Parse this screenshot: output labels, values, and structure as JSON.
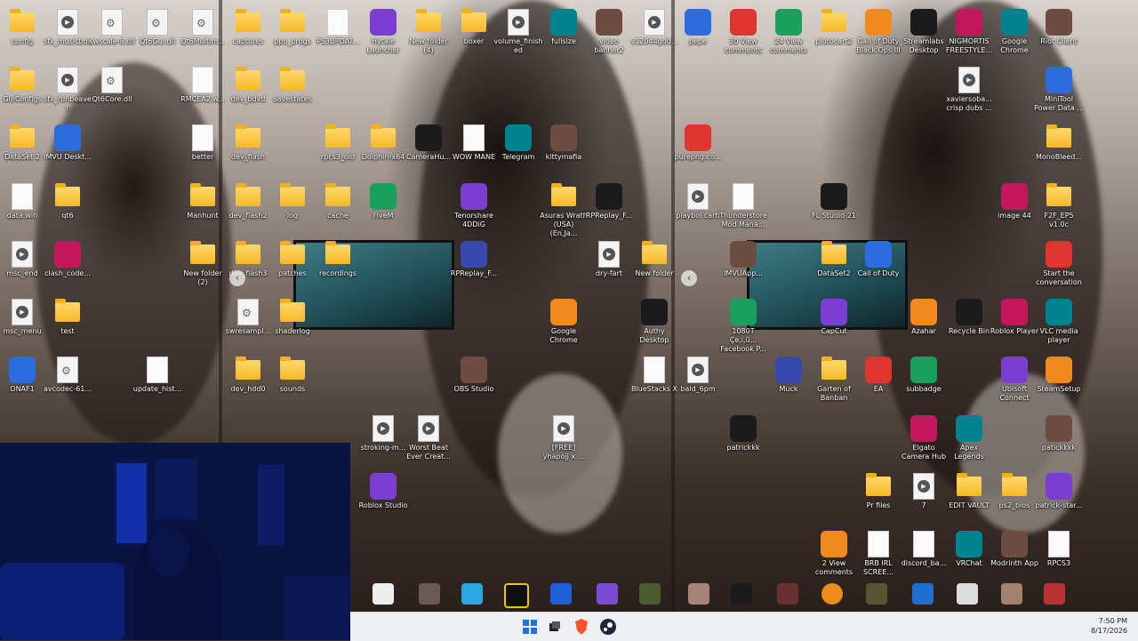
{
  "desktop": {
    "panel1": [
      {
        "label": "config",
        "type": "folder"
      },
      {
        "label": "sfx_musicbox",
        "type": "media"
      },
      {
        "label": "swscale-8.dll",
        "type": "gear"
      },
      {
        "label": "Qt6Gui.dll",
        "type": "gear"
      },
      {
        "label": "Qt6Multim...",
        "type": "gear"
      },
      {
        "label": "GuiConfigs",
        "type": "folder"
      },
      {
        "label": "sfx_runbeaver",
        "type": "media"
      },
      {
        "label": "Qt6Core.dll",
        "type": "gear"
      },
      {
        "label": "RMCEA2.w...",
        "type": "doc"
      },
      {
        "label": "DataSet 2",
        "type": "folder"
      },
      {
        "label": "IMVU Deskt...",
        "type": "app"
      },
      {
        "label": "better",
        "type": "doc"
      },
      {
        "label": "data.win",
        "type": "doc"
      },
      {
        "label": "qt6",
        "type": "folder"
      },
      {
        "label": "Manhunt",
        "type": "folder"
      },
      {
        "label": "msc_end",
        "type": "media"
      },
      {
        "label": "clash_code...",
        "type": "app"
      },
      {
        "label": "New folder (2)",
        "type": "folder"
      },
      {
        "label": "msc_menu",
        "type": "media"
      },
      {
        "label": "test",
        "type": "folder"
      },
      {
        "label": "ONAF1",
        "type": "app"
      },
      {
        "label": "avcodec-61...",
        "type": "gear"
      },
      {
        "label": "update_hist...",
        "type": "doc"
      }
    ],
    "panel2": [
      {
        "label": "captures",
        "type": "folder"
      },
      {
        "label": "ppu_progs",
        "type": "folder"
      },
      {
        "label": "PS3UPDAT...",
        "type": "doc"
      },
      {
        "label": "Hytale Launcher",
        "type": "app"
      },
      {
        "label": "New folder (4)",
        "type": "folder"
      },
      {
        "label": "boxer",
        "type": "folder"
      },
      {
        "label": "volume_finished",
        "type": "media"
      },
      {
        "label": "fullsize",
        "type": "app"
      },
      {
        "label": "video banner2",
        "type": "app"
      },
      {
        "label": "v12044gd0...",
        "type": "media"
      },
      {
        "label": "dev_bdvd",
        "type": "folder"
      },
      {
        "label": "savestates",
        "type": "folder"
      },
      {
        "label": "dev_flash",
        "type": "folder"
      },
      {
        "label": "rpcs3_old",
        "type": "folder"
      },
      {
        "label": "Dolphin-x64",
        "type": "folder"
      },
      {
        "label": "CameraHu...",
        "type": "app"
      },
      {
        "label": "WOW MANE",
        "type": "doc"
      },
      {
        "label": "Telegram",
        "type": "app"
      },
      {
        "label": "kittymafia",
        "type": "app"
      },
      {
        "label": "dev_flash2",
        "type": "folder"
      },
      {
        "label": "log",
        "type": "folder"
      },
      {
        "label": "cache",
        "type": "folder"
      },
      {
        "label": "FiveM",
        "type": "app"
      },
      {
        "label": "Tenorshare 4DDiG",
        "type": "app"
      },
      {
        "label": "Asuras Wrath (USA) (En,Ja...",
        "type": "folder"
      },
      {
        "label": "RPReplay_F...",
        "type": "app"
      },
      {
        "label": "dev_flash3",
        "type": "folder"
      },
      {
        "label": "patches",
        "type": "folder"
      },
      {
        "label": "recordings",
        "type": "folder"
      },
      {
        "label": "RPReplay_F...",
        "type": "app"
      },
      {
        "label": "dry-fart",
        "type": "media"
      },
      {
        "label": "New folder",
        "type": "folder"
      },
      {
        "label": "swresampl...",
        "type": "gear"
      },
      {
        "label": "shaderlog",
        "type": "folder"
      },
      {
        "label": "Google Chrome",
        "type": "app"
      },
      {
        "label": "Authy Desktop",
        "type": "app"
      },
      {
        "label": "dev_hdd0",
        "type": "folder"
      },
      {
        "label": "sounds",
        "type": "folder"
      },
      {
        "label": "OBS Studio",
        "type": "app"
      },
      {
        "label": "BlueStacks X",
        "type": "doc"
      },
      {
        "label": "stroking-m...",
        "type": "media"
      },
      {
        "label": "Worst Beat Ever Creat...",
        "type": "media"
      },
      {
        "label": "[FREE] yhapojj x ...",
        "type": "media"
      },
      {
        "label": "Roblox Studio",
        "type": "app"
      }
    ],
    "panel3": [
      {
        "label": "pepe",
        "type": "app"
      },
      {
        "label": "30 View comments",
        "type": "app"
      },
      {
        "label": "24 View comments",
        "type": "app"
      },
      {
        "label": "plutocart2",
        "type": "folder"
      },
      {
        "label": "Call of Duty Black Ops III",
        "type": "app"
      },
      {
        "label": "Streamlabs Desktop",
        "type": "app"
      },
      {
        "label": "NIGMORTIS FREESTYLE...",
        "type": "app"
      },
      {
        "label": "Google Chrome",
        "type": "app"
      },
      {
        "label": "Riot Client",
        "type": "app"
      },
      {
        "label": "xaviersoba... crisp dubs ...",
        "type": "media"
      },
      {
        "label": "MiniTool Power Data ...",
        "type": "app"
      },
      {
        "label": "purepng.co...",
        "type": "app"
      },
      {
        "label": "MonoBleed...",
        "type": "folder"
      },
      {
        "label": "playboi carti",
        "type": "media"
      },
      {
        "label": "Thunderstore Mod Mana...",
        "type": "doc"
      },
      {
        "label": "FL Studio 21",
        "type": "app"
      },
      {
        "label": "image 44",
        "type": "app"
      },
      {
        "label": "F2F_EP5 v1.0c",
        "type": "folder"
      },
      {
        "label": "IMVUApp...",
        "type": "app"
      },
      {
        "label": "DataSet2",
        "type": "folder"
      },
      {
        "label": "Call of Duty",
        "type": "app"
      },
      {
        "label": "Start the conversation",
        "type": "app"
      },
      {
        "label": "1080T Çe,i,ü... Facebook P...",
        "type": "app"
      },
      {
        "label": "CapCut",
        "type": "app"
      },
      {
        "label": "Azahar",
        "type": "app"
      },
      {
        "label": "Recycle Bin",
        "type": "app"
      },
      {
        "label": "Roblox Player",
        "type": "app"
      },
      {
        "label": "VLC media player",
        "type": "app"
      },
      {
        "label": "bald_6pm",
        "type": "media"
      },
      {
        "label": "Muck",
        "type": "app"
      },
      {
        "label": "Garten of Banban",
        "type": "folder"
      },
      {
        "label": "EA",
        "type": "app"
      },
      {
        "label": "subbadge",
        "type": "app"
      },
      {
        "label": "Ubisoft Connect",
        "type": "app"
      },
      {
        "label": "SteamSetup",
        "type": "app"
      },
      {
        "label": "patrickkk",
        "type": "app"
      },
      {
        "label": "Elgato Camera Hub",
        "type": "app"
      },
      {
        "label": "Apex Legends",
        "type": "app"
      },
      {
        "label": "patickkkk",
        "type": "app"
      },
      {
        "label": "Pr files",
        "type": "folder"
      },
      {
        "label": "7",
        "type": "media"
      },
      {
        "label": "EDIT VAULT",
        "type": "folder"
      },
      {
        "label": "ps2_bios",
        "type": "folder"
      },
      {
        "label": "patrick-star...",
        "type": "app"
      },
      {
        "label": "2 View comments",
        "type": "app"
      },
      {
        "label": "BRB IRL SCREE...",
        "type": "doc"
      },
      {
        "label": "discord_ba...",
        "type": "doc"
      },
      {
        "label": "VRChat",
        "type": "app"
      },
      {
        "label": "Modrinth App",
        "type": "app"
      },
      {
        "label": "RPCS3",
        "type": "doc"
      }
    ]
  },
  "taskbar": {
    "time": "7:50 PM",
    "date": "8/17/2026"
  },
  "nav": {
    "prev_glyph": "‹"
  },
  "colors": {
    "taskbar": "#eef0f3",
    "folder": "#f5b928",
    "webcam_blue": "#1439d6"
  }
}
